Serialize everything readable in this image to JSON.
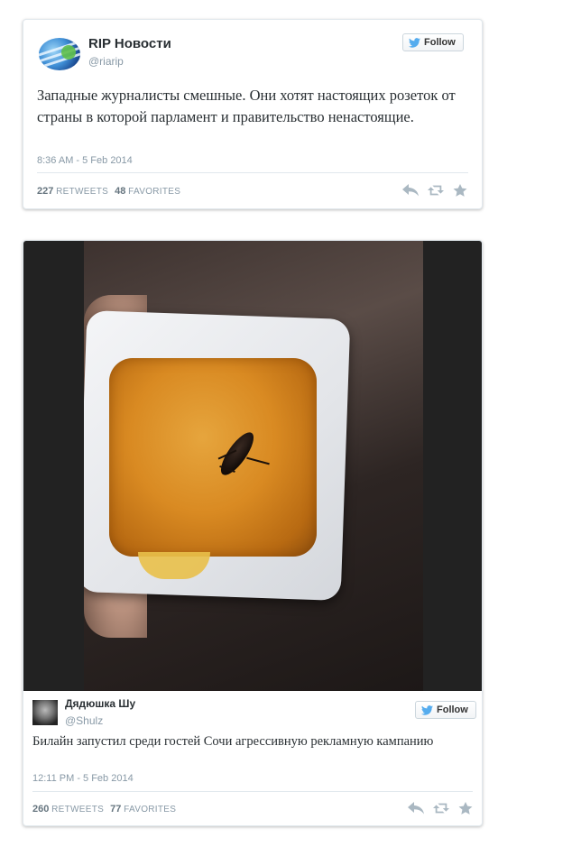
{
  "tweet1": {
    "display_name": "RIP Новости",
    "screen_name": "@riarip",
    "follow_label": "Follow",
    "text": "Западные журналисты смешные. Они хотят настоящих розеток от страны в которой парламент и правительство ненастоящие.",
    "timestamp": "8:36 AM - 5 Feb 2014",
    "retweets": "227",
    "retweets_label": "RETWEETS",
    "favorites": "48",
    "favorites_label": "FAVORITES"
  },
  "tweet2": {
    "display_name": "Дядюшка Шу",
    "screen_name": "@Shulz",
    "follow_label": "Follow",
    "text": "Билайн запустил среди гостей Сочи агрессивную рекламную кампанию",
    "timestamp": "12:11 PM - 5 Feb 2014",
    "retweets": "260",
    "retweets_label": "RETWEETS",
    "favorites": "77",
    "favorites_label": "FAVORITES"
  },
  "icons": {
    "bird": "twitter-bird-icon",
    "reply": "reply-icon",
    "retweet": "retweet-icon",
    "favorite": "star-icon"
  },
  "colors": {
    "twitter_blue": "#55acee",
    "muted_text": "#8899a6",
    "action_gray": "#aab8c2"
  }
}
